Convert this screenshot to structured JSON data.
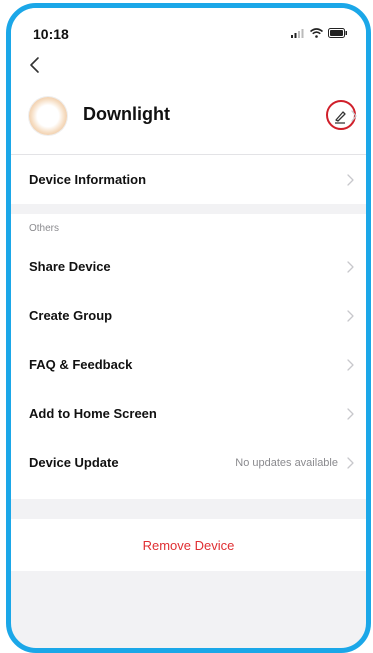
{
  "status_bar": {
    "time": "10:18"
  },
  "device": {
    "name": "Downlight"
  },
  "menu": {
    "device_information": "Device Information",
    "section_others": "Others",
    "share_device": "Share Device",
    "create_group": "Create Group",
    "faq_feedback": "FAQ & Feedback",
    "add_to_home": "Add to Home Screen",
    "device_update": "Device Update",
    "device_update_status": "No updates available"
  },
  "actions": {
    "remove_device": "Remove Device"
  },
  "colors": {
    "frame_accent": "#1ba7e8",
    "highlight_ring": "#d01f2a",
    "danger": "#e02f33"
  },
  "icons": [
    "back-chevron-icon",
    "edit-pencil-icon",
    "chevron-right-icon",
    "signal-icon",
    "wifi-icon",
    "battery-icon"
  ]
}
